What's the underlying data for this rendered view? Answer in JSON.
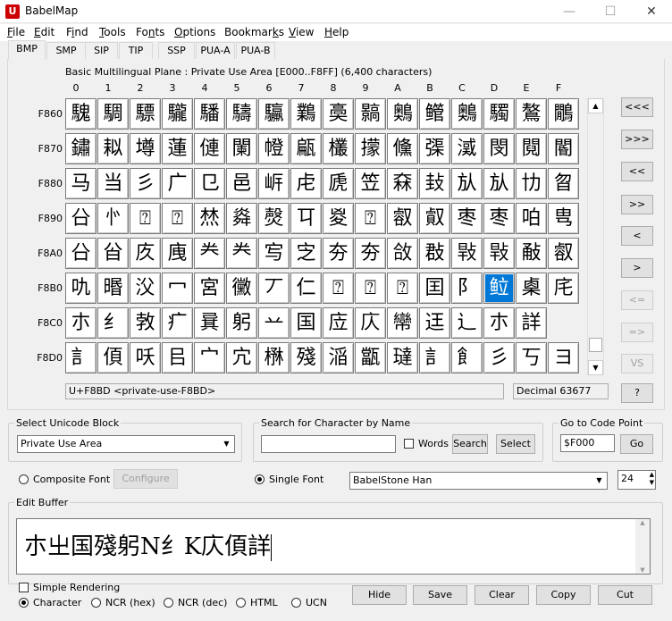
{
  "window": {
    "title": "BabelMap",
    "app_icon": "U",
    "minimize": "—",
    "maximize": "☐",
    "close": "✕"
  },
  "menu": [
    {
      "pre": "",
      "u": "F",
      "post": "ile"
    },
    {
      "pre": "",
      "u": "E",
      "post": "dit"
    },
    {
      "pre": "F",
      "u": "i",
      "post": "nd"
    },
    {
      "pre": "",
      "u": "T",
      "post": "ools"
    },
    {
      "pre": "Fo",
      "u": "n",
      "post": "ts"
    },
    {
      "pre": "",
      "u": "O",
      "post": "ptions"
    },
    {
      "pre": "Bookmar",
      "u": "k",
      "post": "s"
    },
    {
      "pre": "",
      "u": "V",
      "post": "iew"
    },
    {
      "pre": "",
      "u": "H",
      "post": "elp"
    }
  ],
  "tabs": [
    "BMP",
    "SMP",
    "SIP",
    "TIP",
    "SSP",
    "PUA-A",
    "PUA-B"
  ],
  "grid": {
    "title": "Basic Multilingual Plane : Private Use Area [E000..F8FF] (6,400 characters)",
    "col_headers": [
      "0",
      "1",
      "2",
      "3",
      "4",
      "5",
      "6",
      "7",
      "8",
      "9",
      "A",
      "B",
      "C",
      "D",
      "E",
      "F"
    ],
    "row_headers": [
      "F860",
      "F870",
      "F880",
      "F890",
      "F8A0",
      "F8B0",
      "F8C0",
      "F8D0"
    ],
    "rows": [
      [
        "騩",
        "騆",
        "驃",
        "䮾",
        "䮳",
        "䮻",
        "䯁",
        "鸈",
        "䯨",
        "䯫",
        "䴈",
        "鳤",
        "䴈",
        "䮷",
        "鷔",
        "鷳"
      ],
      [
        "鏽",
        "䎣",
        "壿",
        "蓮",
        "僆",
        "闌",
        "㡠",
        "甂",
        "欉",
        "㩚",
        "儵",
        "㣄",
        "㵄",
        "閔",
        "䦧",
        "閽"
      ],
      [
        "马",
        "当",
        "彡",
        "广",
        "㔾",
        "邑",
        "㟁",
        "虍",
        "虒",
        "笠",
        "㚞",
        "㪈",
        "㫃",
        "㫃",
        "㔹",
        "㫚"
      ],
      [
        "㕣",
        "㣺",
        "⍰",
        "⍰",
        "㷊",
        "㷠",
        "㷫",
        "㔿",
        "㚇",
        "⍰",
        "㕡",
        "㕢",
        "枣",
        "枣",
        "㕷",
        "㽕"
      ],
      [
        "㕣",
        "㒶",
        "㡱",
        "㡼",
        "龹",
        "龹",
        "㝍",
        "㝎",
        "夯",
        "夯",
        "㪉",
        "㪊",
        "㪋",
        "㪋",
        "㪌",
        "㕡"
      ],
      [
        "㕤",
        "㬆",
        "㳇",
        "冖",
        "宮",
        "黴",
        "丆",
        "仁",
        "⍰",
        "⍰",
        "⍰",
        "囯",
        "阝",
        "䲞",
        "㮚",
        "㡯"
      ],
      [
        "朩",
        "纟",
        "㪍",
        "疒",
        "㠱",
        "躬",
        "䒑",
        "国",
        "㡴",
        "庂",
        "㡩",
        "迋",
        "辶",
        "朩",
        "詳"
      ],
      [
        "訁",
        "㑯",
        "㕭",
        "㠯",
        "宀",
        "宂",
        "㮊",
        "殘",
        "㴞",
        "㽆",
        "㼀",
        "訁",
        "飠",
        "彡",
        "丂",
        "ヨ"
      ]
    ],
    "selected": {
      "row": 5,
      "col": 13
    },
    "status_left": "U+F8BD <private-use-F8BD>",
    "status_right": "Decimal 63677"
  },
  "nav_buttons": [
    "<<<",
    ">>>",
    "<<",
    ">>",
    "<",
    ">",
    "<=",
    "=>",
    "VS",
    "?"
  ],
  "select_block": {
    "label": "Select Unicode Block",
    "value": "Private Use Area"
  },
  "search": {
    "label": "Search for Character by Name",
    "value": "",
    "words_label": "Words",
    "search_btn": "Search",
    "select_btn": "Select"
  },
  "goto": {
    "label": "Go to Code Point",
    "value": "$F000",
    "go_btn": "Go"
  },
  "font": {
    "composite_label": "Composite Font",
    "configure_btn": "Configure",
    "single_label": "Single Font",
    "font_name": "BabelStone Han",
    "size": "24"
  },
  "edit_buffer": {
    "label": "Edit Buffer",
    "text": "朩㞢国殘躬N纟K庂㑯詳"
  },
  "bottom": {
    "simple_rendering": "Simple Rendering",
    "radios": [
      "Character",
      "NCR (hex)",
      "NCR (dec)",
      "HTML",
      "UCN"
    ],
    "buttons": [
      "Hide",
      "Save",
      "Clear",
      "Copy",
      "Cut"
    ]
  }
}
